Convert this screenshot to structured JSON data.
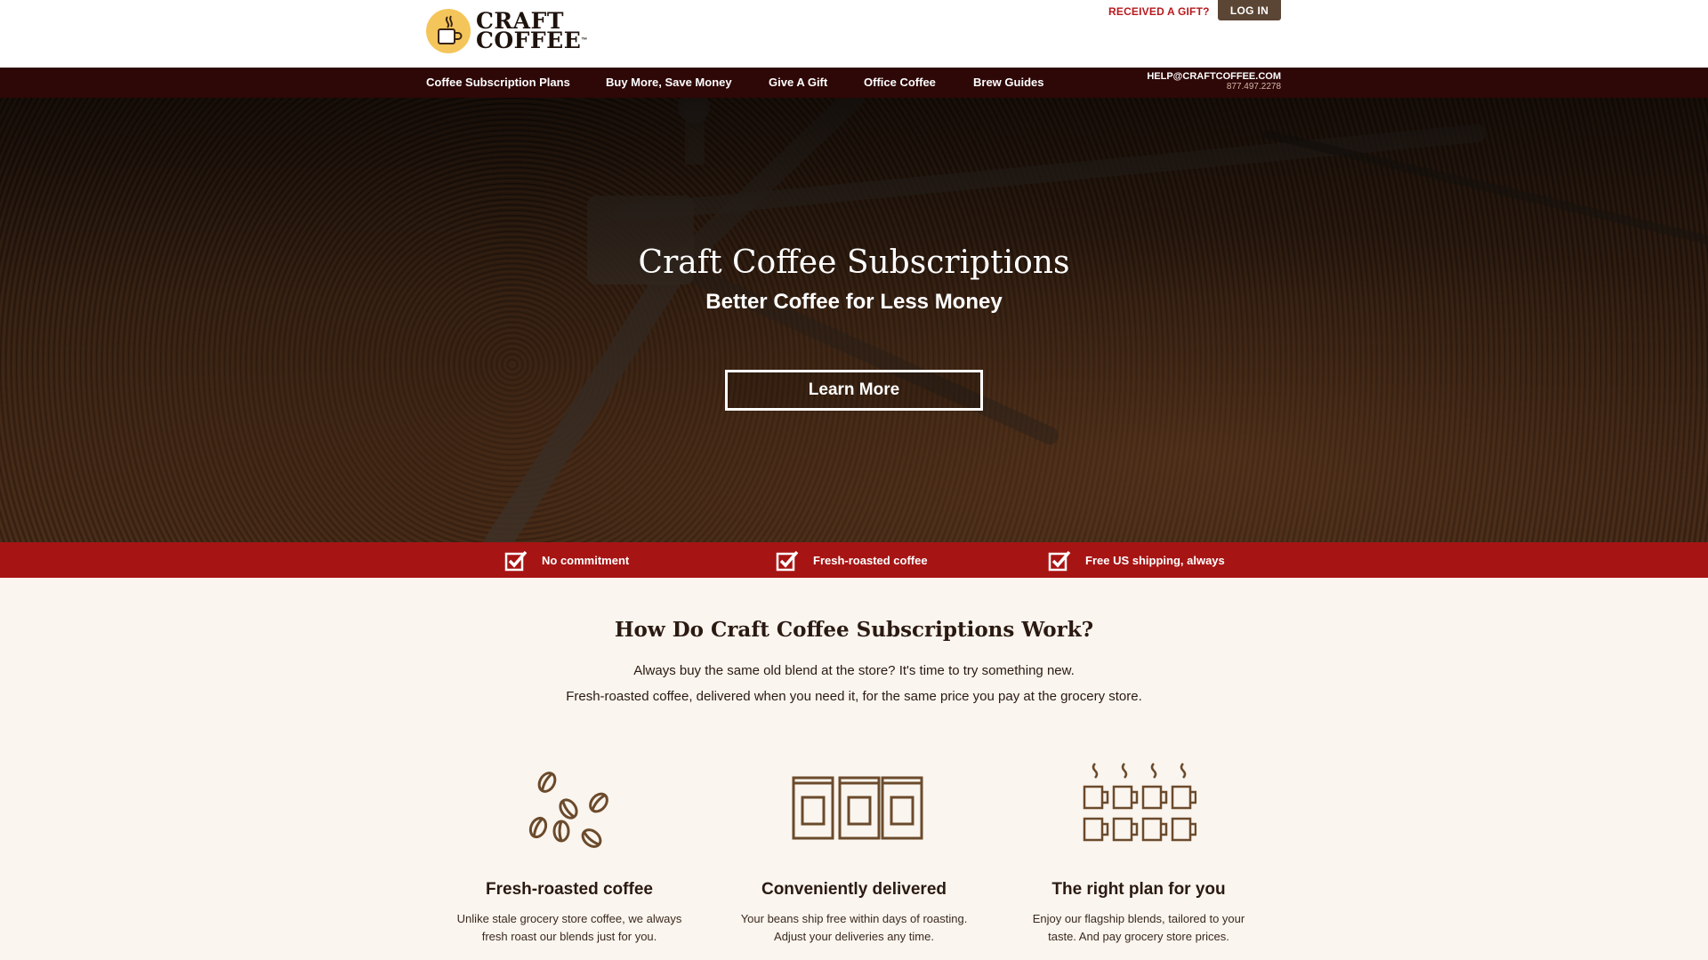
{
  "header": {
    "logo_line1": "CRAFT",
    "logo_line2": "COFFEE",
    "logo_mark": "™",
    "gift_link": "RECEIVED A GIFT?",
    "login_label": "LOG IN"
  },
  "nav": {
    "items": [
      {
        "label": "Coffee Subscription Plans"
      },
      {
        "label": "Buy More, Save Money"
      },
      {
        "label": "Give A Gift"
      },
      {
        "label": "Office Coffee"
      },
      {
        "label": "Brew Guides"
      }
    ],
    "contact_email": "HELP@CRAFTCOFFEE.COM",
    "contact_phone": "877.497.2278"
  },
  "hero": {
    "title": "Craft Coffee Subscriptions",
    "subtitle": "Better Coffee for Less Money",
    "button_label": "Learn More"
  },
  "benefits": [
    {
      "label": "No commitment",
      "icon": "checkbox-icon"
    },
    {
      "label": "Fresh-roasted coffee",
      "icon": "checkbox-icon"
    },
    {
      "label": "Free US shipping, always",
      "icon": "checkbox-icon"
    }
  ],
  "how": {
    "title": "How Do Craft Coffee Subscriptions Work?",
    "line1": "Always buy the same old blend at the store? It's time to try something new.",
    "line2": "Fresh-roasted coffee, delivered when you need it, for the same price you pay at the grocery store."
  },
  "features": [
    {
      "icon": "coffee-beans-icon",
      "title": "Fresh-roasted coffee",
      "desc_line1": "Unlike stale grocery store coffee, we always",
      "desc_line2": "fresh roast our blends just for you."
    },
    {
      "icon": "coffee-bags-icon",
      "title": "Conveniently delivered",
      "desc_line1": "Your beans ship free within days of roasting.",
      "desc_line2": "Adjust your deliveries any time."
    },
    {
      "icon": "coffee-mugs-icon",
      "title": "The right plan for you",
      "desc_line1": "Enjoy our flagship blends, tailored to your",
      "desc_line2": "taste. And pay grocery store prices."
    }
  ],
  "colors": {
    "nav_bg": "#2e0707",
    "benefit_bar": "#a71414",
    "gift_link": "#b7191e",
    "login_bg": "#5b4534",
    "logo_badge": "#f4c55a",
    "page_bg": "#faf5ee",
    "icon_brown": "#6b4a2c"
  }
}
